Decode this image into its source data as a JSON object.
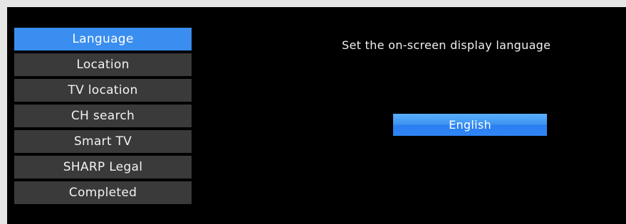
{
  "menu": {
    "items": [
      {
        "label": "Language",
        "active": true
      },
      {
        "label": "Location",
        "active": false
      },
      {
        "label": "TV location",
        "active": false
      },
      {
        "label": "CH search",
        "active": false
      },
      {
        "label": "Smart TV",
        "active": false
      },
      {
        "label": "SHARP Legal",
        "active": false
      },
      {
        "label": "Completed",
        "active": false
      }
    ]
  },
  "panel": {
    "description": "Set the on-screen display language",
    "selected_value": "English"
  },
  "colors": {
    "frame_bg": "#e6e6e6",
    "screen_bg": "#000000",
    "menu_item_bg": "#3a3a3a",
    "accent": "#3a8ef0"
  }
}
